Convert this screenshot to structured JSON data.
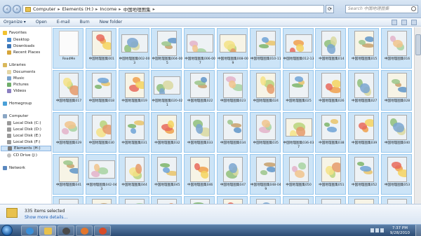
{
  "address": {
    "crumbs": [
      "Computer",
      "Elements (H:)",
      "Income",
      "中国地理图集"
    ],
    "search_placeholder": "Search 中国地理图集"
  },
  "toolbar": {
    "organize": "Organize ▾",
    "open": "Open",
    "email": "E-mail",
    "burn": "Burn",
    "new_folder": "New folder"
  },
  "nav": {
    "favorites": "Favorites",
    "desktop": "Desktop",
    "downloads": "Downloads",
    "recent": "Recent Places",
    "libraries": "Libraries",
    "documents": "Documents",
    "music": "Music",
    "pictures": "Pictures",
    "videos": "Videos",
    "homegroup": "Homegroup",
    "computer": "Computer",
    "disk_c": "Local Disk (C:)",
    "disk_d": "Local Disk (D:)",
    "disk_e": "Local Disk (E:)",
    "disk_f": "Local Disk (F:)",
    "elements": "Elements (H:)",
    "cd": "CD Drive (J:)",
    "network": "Network"
  },
  "files": [
    "ReadMe",
    "中国地理图集001",
    "中国地理图集002-003",
    "中国地理图集004-005",
    "中国地理图集006-007",
    "中国地理图集008-009",
    "中国地理图集010-11",
    "中国地理图集012-13",
    "中国地理图集014",
    "中国地理图集015",
    "中国地理图集016",
    "中国地理图集017",
    "中国地理图集018",
    "中国地理图集019",
    "中国地理图集020-021",
    "中国地理图集022",
    "中国地理图集023",
    "中国地理图集024",
    "中国地理图集025",
    "中国地理图集026",
    "中国地理图集027",
    "中国地理图集028",
    "中国地理图集029",
    "中国地理图集030",
    "中国地理图集031",
    "中国地理图集032",
    "中国地理图集033",
    "中国地理图集034",
    "中国地理图集035",
    "中国地理图集036-037",
    "中国地理图集038",
    "中国地理图集039",
    "中国地理图集040",
    "中国地理图集041",
    "中国地理图集042-043",
    "中国地理图集044",
    "中国地理图集045",
    "中国地理图集046",
    "中国地理图集047",
    "中国地理图集048-049",
    "中国地理图集050",
    "中国地理图集051",
    "中国地理图集052",
    "中国地理图集053",
    "",
    "",
    "",
    "",
    "",
    "",
    "",
    "",
    "",
    "",
    ""
  ],
  "details": {
    "count": "335 items selected",
    "more": "Show more details..."
  },
  "clock": {
    "time": "7:37 PM",
    "date": "9/28/2010"
  }
}
